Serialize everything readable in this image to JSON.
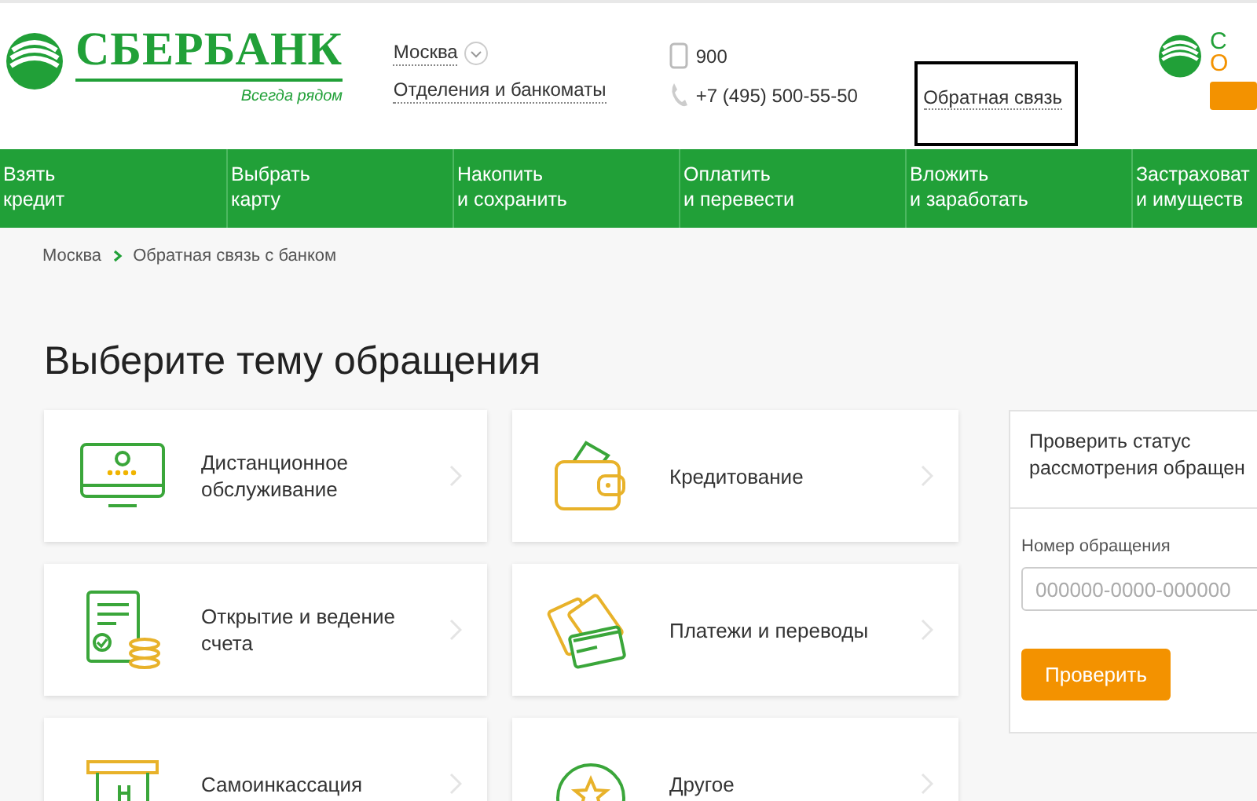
{
  "header": {
    "logo": {
      "name": "СБЕРБАНК",
      "slogan": "Всегда рядом"
    },
    "city": {
      "label": "Москва"
    },
    "branches_link": "Отделения и банкоматы",
    "phones": [
      {
        "kind": "mobile",
        "number": "900"
      },
      {
        "kind": "landline",
        "number": "+7 (495) 500-55-50"
      }
    ],
    "feedback_link": {
      "label": "Обратная связь",
      "highlighted": true
    },
    "online_logo": {
      "line_1": "С",
      "line_2": "О"
    }
  },
  "nav": [
    {
      "line_1": "Взять",
      "line_2": "кредит"
    },
    {
      "line_1": "Выбрать",
      "line_2": "карту"
    },
    {
      "line_1": "Накопить",
      "line_2": "и сохранить"
    },
    {
      "line_1": "Оплатить",
      "line_2": "и перевести"
    },
    {
      "line_1": "Вложить",
      "line_2": "и заработать"
    },
    {
      "line_1": "Застраховат",
      "line_2": "и имуществ"
    }
  ],
  "breadcrumbs": [
    "Москва",
    "Обратная связь с банком"
  ],
  "title": "Выберите тему обращения",
  "topics": [
    {
      "kind": "monitor",
      "label": "Дистанционное обслуживание"
    },
    {
      "kind": "wallet",
      "label": "Кредитование"
    },
    {
      "kind": "document",
      "label": "Открытие и ведение счета"
    },
    {
      "kind": "cards",
      "label": "Платежи и переводы"
    },
    {
      "kind": "atm",
      "label": "Самоинкассация"
    },
    {
      "kind": "star",
      "label": "Другое"
    }
  ],
  "status_panel": {
    "heading_line_1": "Проверить статус",
    "heading_line_2": "рассмотрения обращен",
    "field_label": "Номер обращения",
    "placeholder": "000000-0000-000000",
    "button": "Проверить"
  }
}
